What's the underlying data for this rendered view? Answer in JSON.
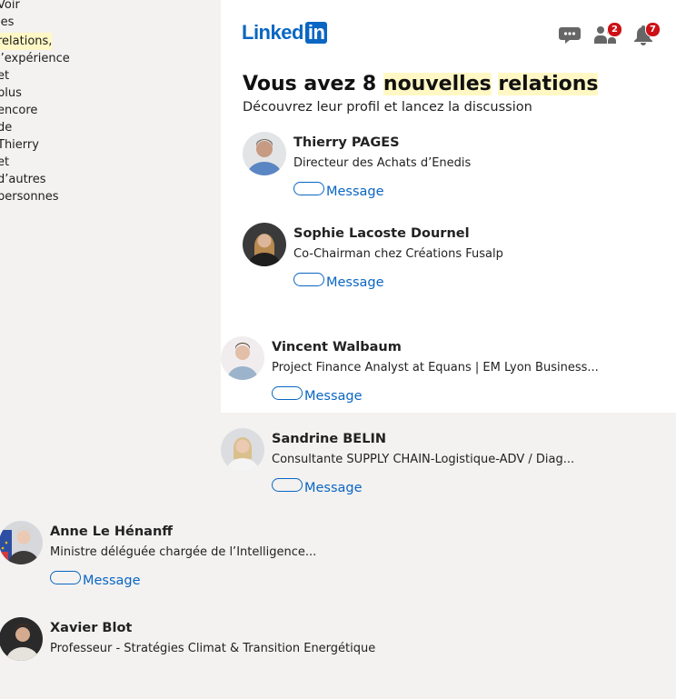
{
  "preheader": {
    "words": [
      "Voir",
      "les",
      "relations,",
      "l’expérience",
      "et",
      "plus",
      "encore",
      "de",
      "Thierry",
      "et",
      "d’autres",
      "personnes"
    ],
    "highlight_index": 2
  },
  "brand": {
    "logo_text": "Linked",
    "logo_in": "in",
    "accent": "#0a66c2"
  },
  "header": {
    "messaging_icon": "chat-bubble-icon",
    "network_icon": "people-icon",
    "network_badge": "2",
    "notifications_icon": "bell-icon",
    "notifications_badge": "7",
    "badge_color": "#cc1016"
  },
  "main": {
    "title_prefix": "Vous avez 8 ",
    "title_hl1": "nouvelles",
    "title_hl2": "relations",
    "subtitle": "Découvrez leur profil et lancez la discussion",
    "message_label": "Message",
    "people": [
      {
        "name": "Thierry PAGES",
        "title": "Directeur des Achats d’Enedis",
        "avatar": "avatar-icon"
      },
      {
        "name": "Sophie Lacoste Dournel",
        "title": "Co-Chairman chez Créations Fusalp",
        "avatar": "avatar-icon"
      },
      {
        "name": "Vincent Walbaum",
        "title": "Project Finance Analyst at Equans | EM Lyon Business...",
        "avatar": "avatar-icon"
      },
      {
        "name": "Sandrine BELIN",
        "title": "Consultante SUPPLY CHAIN-Logistique-ADV / Diag...",
        "avatar": "avatar-icon"
      },
      {
        "name": "Anne Le Hénanff",
        "title": "Ministre déléguée chargée de l’Intelligence...",
        "avatar": "avatar-icon"
      },
      {
        "name": "Xavier Blot",
        "title": "Professeur - Stratégies Climat & Transition Energétique",
        "avatar": "avatar-icon"
      }
    ]
  }
}
